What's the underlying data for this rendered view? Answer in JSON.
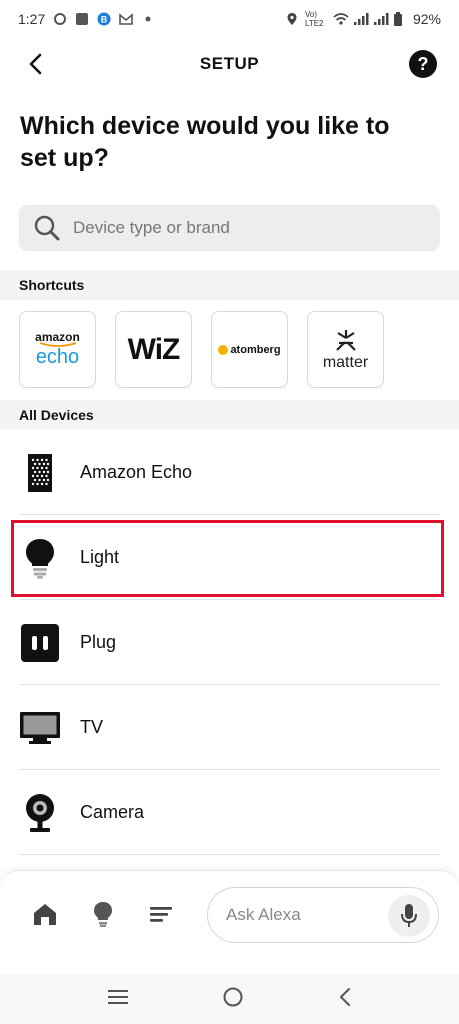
{
  "status_bar": {
    "time": "1:27",
    "network_label": "Vo) LTE2",
    "battery": "92%"
  },
  "header": {
    "title": "SETUP",
    "help_label": "?"
  },
  "question": "Which device would you like to set up?",
  "search": {
    "placeholder": "Device type or brand",
    "value": ""
  },
  "sections": {
    "shortcuts": "Shortcuts",
    "all_devices": "All Devices"
  },
  "shortcuts": [
    {
      "brand_line1": "amazon",
      "brand_line2": "echo",
      "icon": "amazon-echo-logo"
    },
    {
      "brand": "WiZ",
      "icon": "wiz-logo"
    },
    {
      "brand": "atomberg",
      "icon": "atomberg-logo"
    },
    {
      "brand": "matter",
      "icon": "matter-logo"
    }
  ],
  "devices": [
    {
      "label": "Amazon Echo",
      "icon": "speaker-icon"
    },
    {
      "label": "Light",
      "icon": "bulb-icon",
      "highlighted": true
    },
    {
      "label": "Plug",
      "icon": "plug-icon"
    },
    {
      "label": "TV",
      "icon": "tv-icon"
    },
    {
      "label": "Camera",
      "icon": "camera-icon"
    }
  ],
  "bottom_nav": {
    "ask_placeholder": "Ask Alexa",
    "items": [
      "home-icon",
      "devices-icon",
      "more-icon",
      "mic-icon"
    ]
  },
  "colors": {
    "highlight": "#e0102f",
    "echo_blue": "#1a9bd7",
    "search_bg": "#eceded"
  }
}
